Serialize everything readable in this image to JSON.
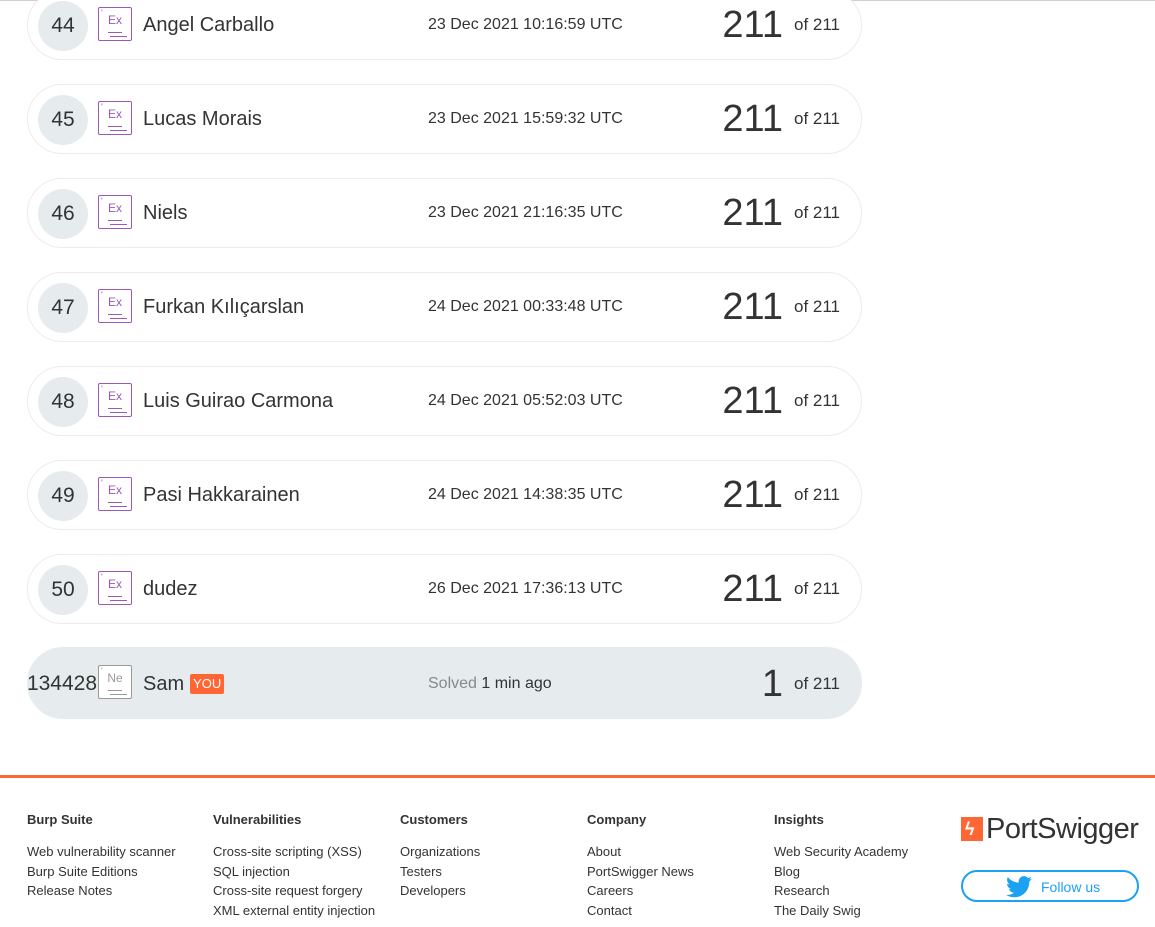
{
  "leaderboard": {
    "rows": [
      {
        "rank": "44",
        "level": "Ex",
        "name": "Angel Carballo",
        "date": "23 Dec 2021 10:16:59 UTC",
        "score": "211",
        "of_text": "of 211"
      },
      {
        "rank": "45",
        "level": "Ex",
        "name": "Lucas Morais",
        "date": "23 Dec 2021 15:59:32 UTC",
        "score": "211",
        "of_text": "of 211"
      },
      {
        "rank": "46",
        "level": "Ex",
        "name": "Niels",
        "date": "23 Dec 2021 21:16:35 UTC",
        "score": "211",
        "of_text": "of 211"
      },
      {
        "rank": "47",
        "level": "Ex",
        "name": "Furkan Kılıçarslan",
        "date": "24 Dec 2021 00:33:48 UTC",
        "score": "211",
        "of_text": "of 211"
      },
      {
        "rank": "48",
        "level": "Ex",
        "name": "Luis Guirao Carmona",
        "date": "24 Dec 2021 05:52:03 UTC",
        "score": "211",
        "of_text": "of 211"
      },
      {
        "rank": "49",
        "level": "Ex",
        "name": "Pasi Hakkarainen",
        "date": "24 Dec 2021 14:38:35 UTC",
        "score": "211",
        "of_text": "of 211"
      },
      {
        "rank": "50",
        "level": "Ex",
        "name": "dudez",
        "date": "26 Dec 2021 17:36:13 UTC",
        "score": "211",
        "of_text": "of 211"
      }
    ],
    "current_user": {
      "rank": "134428",
      "level": "Ne",
      "name": "Sam",
      "you_badge": "YOU",
      "solved_label": "Solved",
      "solved_time": "1 min ago",
      "score": "1",
      "of_text": "of 211"
    }
  },
  "footer": {
    "columns": [
      {
        "heading": "Burp Suite",
        "links": [
          "Web vulnerability scanner",
          "Burp Suite Editions",
          "Release Notes"
        ]
      },
      {
        "heading": "Vulnerabilities",
        "links": [
          "Cross-site scripting (XSS)",
          "SQL injection",
          "Cross-site request forgery",
          "XML external entity injection"
        ]
      },
      {
        "heading": "Customers",
        "links": [
          "Organizations",
          "Testers",
          "Developers"
        ]
      },
      {
        "heading": "Company",
        "links": [
          "About",
          "PortSwigger News",
          "Careers",
          "Contact"
        ]
      },
      {
        "heading": "Insights",
        "links": [
          "Web Security Academy",
          "Blog",
          "Research",
          "The Daily Swig"
        ]
      }
    ],
    "logo_text": "PortSwigger",
    "follow_label": "Follow us"
  },
  "colors": {
    "accent": "#ff6633",
    "expert_badge": "#9b59b6",
    "twitter": "#1da1f2",
    "rank_circle": "#e6eced"
  },
  "icons": [
    "level-badge-icon",
    "portswigger-logo-icon",
    "twitter-icon"
  ]
}
